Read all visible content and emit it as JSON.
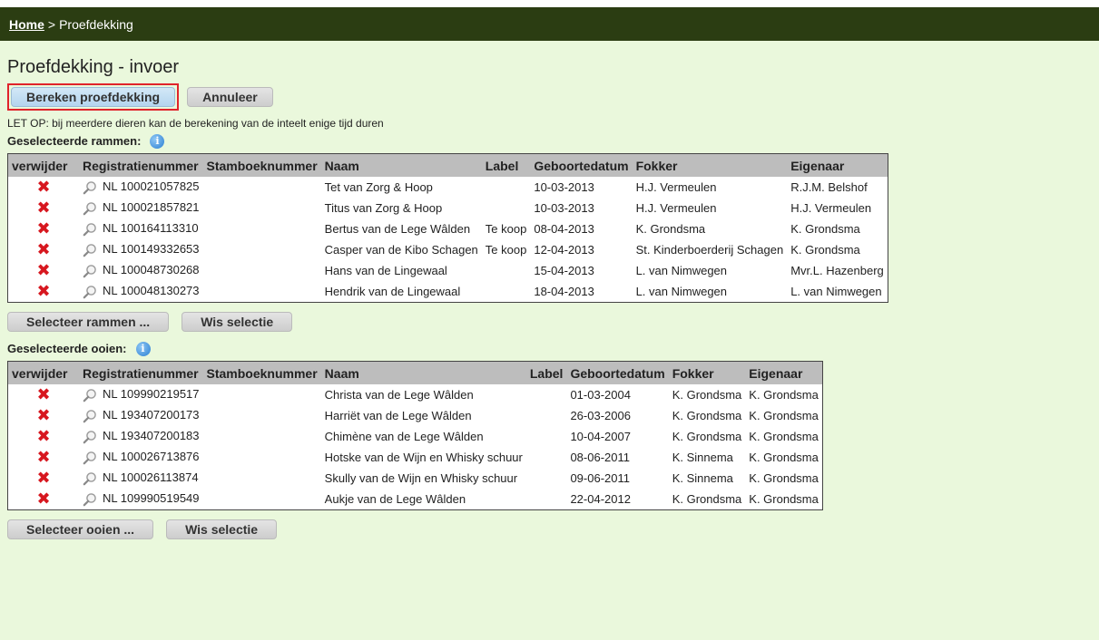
{
  "breadcrumb": {
    "home": "Home",
    "separator": ">",
    "current": "Proefdekking"
  },
  "page_title": "Proefdekking - invoer",
  "buttons": {
    "calculate": "Bereken proefdekking",
    "cancel": "Annuleer"
  },
  "note": "LET OP: bij meerdere dieren kan de berekening van de inteelt enige tijd duren",
  "rams": {
    "label": "Geselecteerde rammen:",
    "headers": [
      "verwijder",
      "Registratienummer",
      "Stamboeknummer",
      "Naam",
      "Label",
      "Geboortedatum",
      "Fokker",
      "Eigenaar"
    ],
    "rows": [
      {
        "reg": "NL 100021057825",
        "stamboek": "",
        "naam": "Tet van Zorg & Hoop",
        "label": "",
        "geboorte": "10-03-2013",
        "fokker": "H.J. Vermeulen",
        "eigenaar": "R.J.M. Belshof"
      },
      {
        "reg": "NL 100021857821",
        "stamboek": "",
        "naam": "Titus van Zorg & Hoop",
        "label": "",
        "geboorte": "10-03-2013",
        "fokker": "H.J. Vermeulen",
        "eigenaar": "H.J. Vermeulen"
      },
      {
        "reg": "NL 100164113310",
        "stamboek": "",
        "naam": "Bertus van de Lege Wâlden",
        "label": "Te koop",
        "geboorte": "08-04-2013",
        "fokker": "K. Grondsma",
        "eigenaar": "K. Grondsma"
      },
      {
        "reg": "NL 100149332653",
        "stamboek": "",
        "naam": "Casper van de Kibo Schagen",
        "label": "Te koop",
        "geboorte": "12-04-2013",
        "fokker": "St. Kinderboerderij Schagen",
        "eigenaar": "K. Grondsma"
      },
      {
        "reg": "NL 100048730268",
        "stamboek": "",
        "naam": "Hans van de Lingewaal",
        "label": "",
        "geboorte": "15-04-2013",
        "fokker": "L. van Nimwegen",
        "eigenaar": "Mvr.L. Hazenberg"
      },
      {
        "reg": "NL 100048130273",
        "stamboek": "",
        "naam": "Hendrik van de Lingewaal",
        "label": "",
        "geboorte": "18-04-2013",
        "fokker": "L. van Nimwegen",
        "eigenaar": "L. van Nimwegen"
      }
    ],
    "select_button": "Selecteer rammen ...",
    "clear_button": "Wis selectie"
  },
  "ewes": {
    "label": "Geselecteerde ooien:",
    "headers": [
      "verwijder",
      "Registratienummer",
      "Stamboeknummer",
      "Naam",
      "Label",
      "Geboortedatum",
      "Fokker",
      "Eigenaar"
    ],
    "rows": [
      {
        "reg": "NL 109990219517",
        "stamboek": "",
        "naam": "Christa van de Lege Wâlden",
        "label": "",
        "geboorte": "01-03-2004",
        "fokker": "K. Grondsma",
        "eigenaar": "K. Grondsma"
      },
      {
        "reg": "NL 193407200173",
        "stamboek": "",
        "naam": "Harriët van de Lege Wâlden",
        "label": "",
        "geboorte": "26-03-2006",
        "fokker": "K. Grondsma",
        "eigenaar": "K. Grondsma"
      },
      {
        "reg": "NL 193407200183",
        "stamboek": "",
        "naam": "Chimène van de Lege Wâlden",
        "label": "",
        "geboorte": "10-04-2007",
        "fokker": "K. Grondsma",
        "eigenaar": "K. Grondsma"
      },
      {
        "reg": "NL 100026713876",
        "stamboek": "",
        "naam": "Hotske van de Wijn en Whisky schuur",
        "label": "",
        "geboorte": "08-06-2011",
        "fokker": "K. Sinnema",
        "eigenaar": "K. Grondsma"
      },
      {
        "reg": "NL 100026113874",
        "stamboek": "",
        "naam": "Skully van de Wijn en Whisky schuur",
        "label": "",
        "geboorte": "09-06-2011",
        "fokker": "K. Sinnema",
        "eigenaar": "K. Grondsma"
      },
      {
        "reg": "NL 109990519549",
        "stamboek": "",
        "naam": "Aukje van de Lege Wâlden",
        "label": "",
        "geboorte": "22-04-2012",
        "fokker": "K. Grondsma",
        "eigenaar": "K. Grondsma"
      }
    ],
    "select_button": "Selecteer ooien ...",
    "clear_button": "Wis selectie"
  },
  "icons": {
    "delete": "delete-x-icon",
    "view": "magnifier-icon",
    "info": "info-icon"
  },
  "colors": {
    "topbar": "#2b3d12",
    "page_bg": "#eaf8dc",
    "header_bg": "#bdbdbd",
    "delete_red": "#d7171f",
    "highlight_border": "#e0232b"
  }
}
